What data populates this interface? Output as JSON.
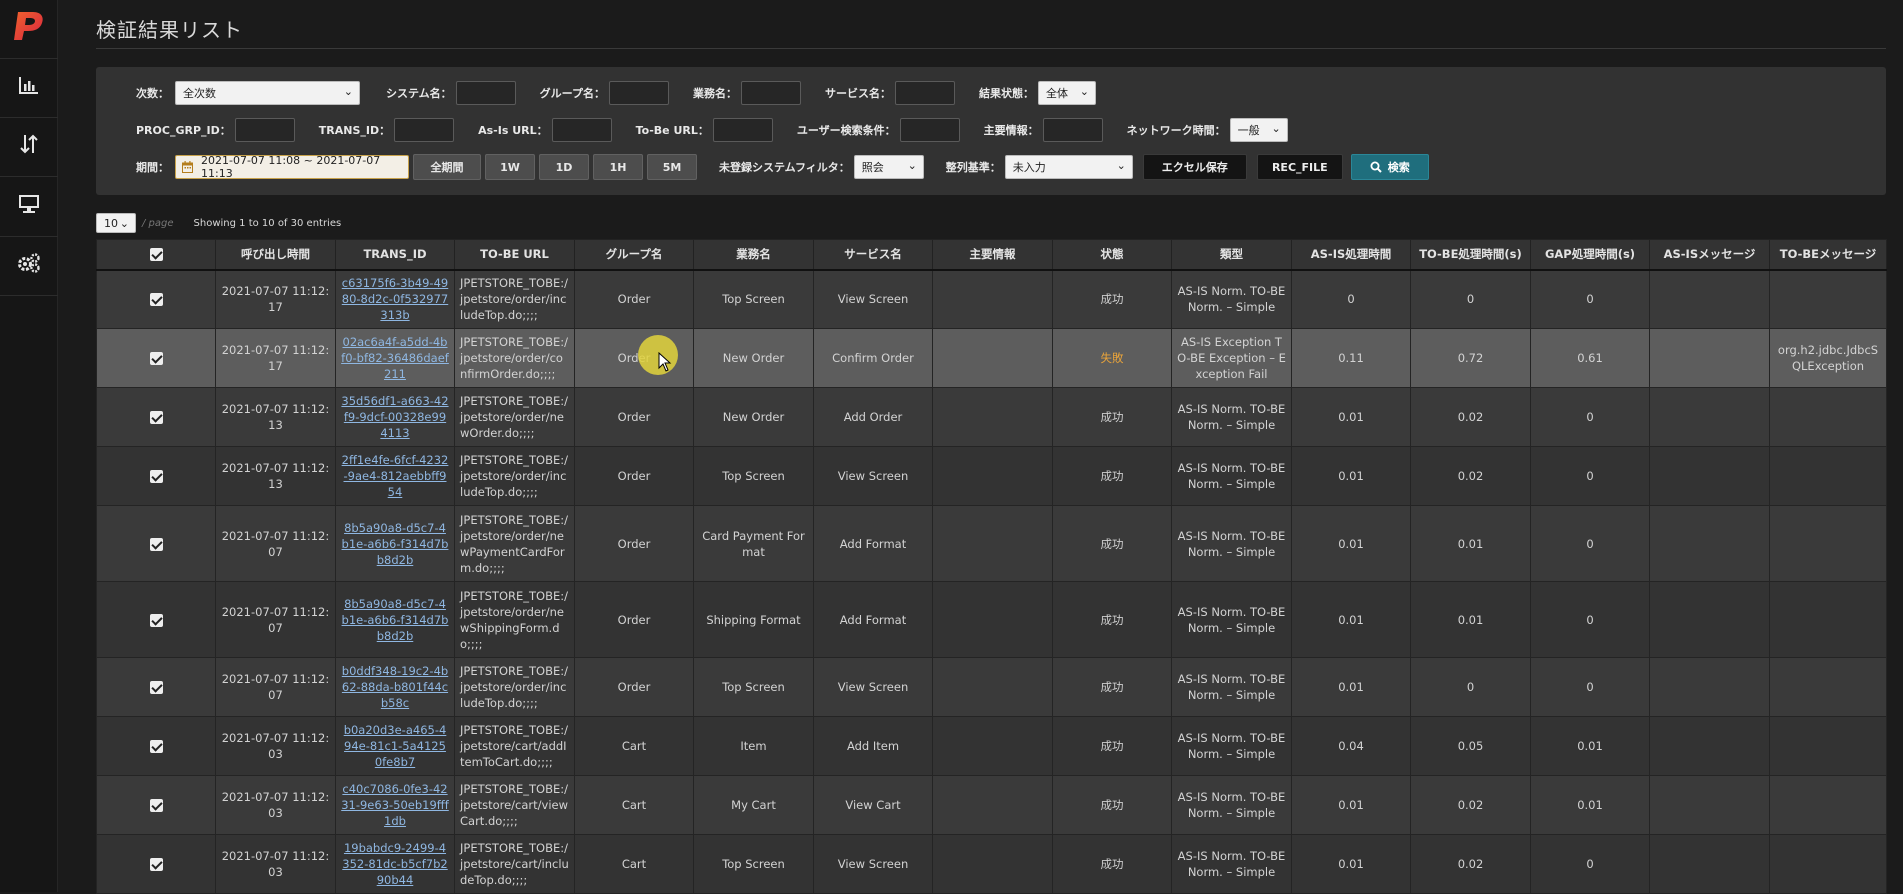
{
  "app": {
    "logo": "P",
    "title": "検証結果リスト"
  },
  "sidebar": {
    "items": [
      {
        "icon": "bar-chart-icon"
      },
      {
        "icon": "sort-icon"
      },
      {
        "icon": "monitor-icon"
      },
      {
        "icon": "gears-icon"
      }
    ]
  },
  "filters": {
    "degree_label": "次数：",
    "degree_value": "全次数",
    "system_label": "システム名：",
    "group_label": "グループ名：",
    "business_label": "業務名：",
    "service_label": "サービス名：",
    "result_label": "結果状態：",
    "result_value": "全体",
    "proc_grp_label": "PROC_GRP_ID：",
    "trans_label": "TRANS_ID：",
    "asis_url_label": "As-Is URL：",
    "tobe_url_label": "To-Be URL：",
    "user_search_label": "ユーザー検索条件：",
    "main_info_label": "主要情報：",
    "network_label": "ネットワーク時間：",
    "network_value": "一般",
    "period_label": "期間：",
    "date_range": "2021-07-07 11:08 ~ 2021-07-07 11:13",
    "period_buttons": [
      "全期間",
      "1W",
      "1D",
      "1H",
      "5M"
    ],
    "unregistered_label": "未登録システムフィルタ：",
    "unregistered_value": "照会",
    "sort_label": "整列基準：",
    "sort_value": "未入力",
    "excel_button": "エクセル保存",
    "recfile_button": "REC_FILE",
    "search_button": "検索"
  },
  "pagination": {
    "page_size": "10",
    "per_page": "/ page",
    "showing": "Showing 1 to 10 of 30 entries"
  },
  "table": {
    "headers": [
      "呼び出し時間",
      "TRANS_ID",
      "TO-BE URL",
      "グループ名",
      "業務名",
      "サービス名",
      "主要情報",
      "状態",
      "類型",
      "AS-IS処理時間",
      "TO-BE処理時間(s)",
      "GAP処理時間(s)",
      "AS-ISメッセージ",
      "TO-BEメッセージ"
    ],
    "rows": [
      {
        "time": "2021-07-07 11:12:17",
        "trans_id": "c63175f6-3b49-4980-8d2c-0f532977313b",
        "url": "JPETSTORE_TOBE:/jpetstore/order/includeTop.do;;;;",
        "group": "Order",
        "business": "Top Screen",
        "service": "View Screen",
        "info": "",
        "status": "成功",
        "type": "AS-IS Norm. TO-BE Norm. – Simple",
        "asis": "0",
        "tobe": "0",
        "gap": "0",
        "asis_msg": "",
        "tobe_msg": ""
      },
      {
        "time": "2021-07-07 11:12:17",
        "trans_id": "02ac6a4f-a5dd-4bf0-bf82-36486daef211",
        "url": "JPETSTORE_TOBE:/jpetstore/order/confirmOrder.do;;;;",
        "group": "Order",
        "business": "New Order",
        "service": "Confirm Order",
        "info": "",
        "status": "失敗",
        "type": "AS-IS Exception TO-BE Exception – Exception Fail",
        "asis": "0.11",
        "tobe": "0.72",
        "gap": "0.61",
        "asis_msg": "",
        "tobe_msg": "org.h2.jdbc.JdbcSQLException"
      },
      {
        "time": "2021-07-07 11:12:13",
        "trans_id": "35d56df1-a663-42f9-9dcf-00328e994113",
        "url": "JPETSTORE_TOBE:/jpetstore/order/newOrder.do;;;;",
        "group": "Order",
        "business": "New Order",
        "service": "Add Order",
        "info": "",
        "status": "成功",
        "type": "AS-IS Norm. TO-BE Norm. – Simple",
        "asis": "0.01",
        "tobe": "0.02",
        "gap": "0",
        "asis_msg": "",
        "tobe_msg": ""
      },
      {
        "time": "2021-07-07 11:12:13",
        "trans_id": "2ff1e4fe-6fcf-4232-9ae4-812aebbff954",
        "url": "JPETSTORE_TOBE:/jpetstore/order/includeTop.do;;;;",
        "group": "Order",
        "business": "Top Screen",
        "service": "View Screen",
        "info": "",
        "status": "成功",
        "type": "AS-IS Norm. TO-BE Norm. – Simple",
        "asis": "0.01",
        "tobe": "0.02",
        "gap": "0",
        "asis_msg": "",
        "tobe_msg": ""
      },
      {
        "time": "2021-07-07 11:12:07",
        "trans_id": "8b5a90a8-d5c7-4b1e-a6b6-f314d7bb8d2b",
        "url": "JPETSTORE_TOBE:/jpetstore/order/newPaymentCardForm.do;;;;",
        "group": "Order",
        "business": "Card Payment Format",
        "service": "Add Format",
        "info": "",
        "status": "成功",
        "type": "AS-IS Norm. TO-BE Norm. – Simple",
        "asis": "0.01",
        "tobe": "0.01",
        "gap": "0",
        "asis_msg": "",
        "tobe_msg": ""
      },
      {
        "time": "2021-07-07 11:12:07",
        "trans_id": "8b5a90a8-d5c7-4b1e-a6b6-f314d7bb8d2b",
        "url": "JPETSTORE_TOBE:/jpetstore/order/newShippingForm.do;;;;",
        "group": "Order",
        "business": "Shipping Format",
        "service": "Add Format",
        "info": "",
        "status": "成功",
        "type": "AS-IS Norm. TO-BE Norm. – Simple",
        "asis": "0.01",
        "tobe": "0.01",
        "gap": "0",
        "asis_msg": "",
        "tobe_msg": ""
      },
      {
        "time": "2021-07-07 11:12:07",
        "trans_id": "b0ddf348-19c2-4b62-88da-b801f44cb58c",
        "url": "JPETSTORE_TOBE:/jpetstore/order/includeTop.do;;;;",
        "group": "Order",
        "business": "Top Screen",
        "service": "View Screen",
        "info": "",
        "status": "成功",
        "type": "AS-IS Norm. TO-BE Norm. – Simple",
        "asis": "0.01",
        "tobe": "0",
        "gap": "0",
        "asis_msg": "",
        "tobe_msg": ""
      },
      {
        "time": "2021-07-07 11:12:03",
        "trans_id": "b0a20d3e-a465-494e-81c1-5a41250fe8b7",
        "url": "JPETSTORE_TOBE:/jpetstore/cart/addItemToCart.do;;;;",
        "group": "Cart",
        "business": "Item",
        "service": "Add Item",
        "info": "",
        "status": "成功",
        "type": "AS-IS Norm. TO-BE Norm. – Simple",
        "asis": "0.04",
        "tobe": "0.05",
        "gap": "0.01",
        "asis_msg": "",
        "tobe_msg": ""
      },
      {
        "time": "2021-07-07 11:12:03",
        "trans_id": "c40c7086-0fe3-4231-9e63-50eb19fff1db",
        "url": "JPETSTORE_TOBE:/jpetstore/cart/viewCart.do;;;;",
        "group": "Cart",
        "business": "My Cart",
        "service": "View Cart",
        "info": "",
        "status": "成功",
        "type": "AS-IS Norm. TO-BE Norm. – Simple",
        "asis": "0.01",
        "tobe": "0.02",
        "gap": "0.01",
        "asis_msg": "",
        "tobe_msg": ""
      },
      {
        "time": "2021-07-07 11:12:03",
        "trans_id": "19babdc9-2499-4352-81dc-b5cf7b290b44",
        "url": "JPETSTORE_TOBE:/jpetstore/cart/includeTop.do;;;;",
        "group": "Cart",
        "business": "Top Screen",
        "service": "View Screen",
        "info": "",
        "status": "成功",
        "type": "AS-IS Norm. TO-BE Norm. – Simple",
        "asis": "0.01",
        "tobe": "0.02",
        "gap": "0",
        "asis_msg": "",
        "tobe_msg": ""
      }
    ]
  },
  "colors": {
    "accent": "#1f6e7d",
    "fail": "#e8a33a",
    "link": "#8fb7e2",
    "logo": "#e8413a"
  }
}
